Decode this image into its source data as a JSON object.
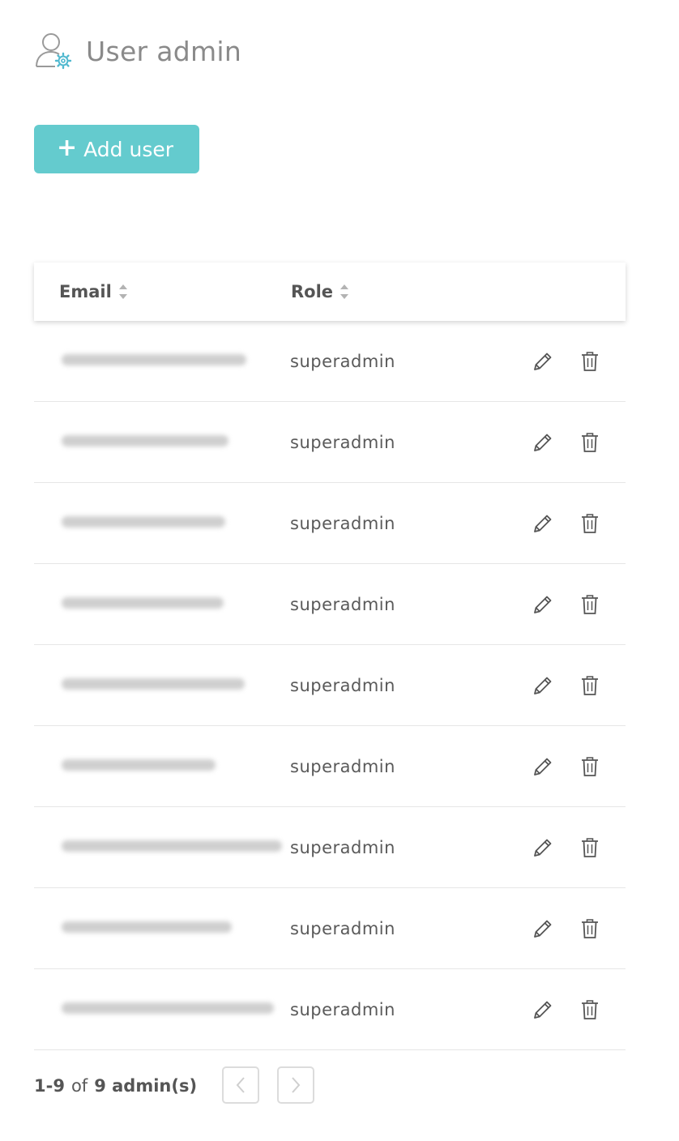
{
  "header": {
    "title": "User admin",
    "icon": "user-gear-icon"
  },
  "toolbar": {
    "add_label": "Add user",
    "add_icon": "plus-icon"
  },
  "table": {
    "columns": [
      {
        "label": "Email",
        "sort_icon": "sort-icon"
      },
      {
        "label": "Role",
        "sort_icon": "sort-icon"
      }
    ],
    "rows": [
      {
        "role": "superadmin"
      },
      {
        "role": "superadmin"
      },
      {
        "role": "superadmin"
      },
      {
        "role": "superadmin"
      },
      {
        "role": "superadmin"
      },
      {
        "role": "superadmin"
      },
      {
        "role": "superadmin"
      },
      {
        "role": "superadmin"
      },
      {
        "role": "superadmin"
      }
    ],
    "row_actions": [
      "pencil-icon",
      "trash-icon"
    ]
  },
  "pagination": {
    "range": "1-9",
    "of": "of",
    "total": "9 admin(s)",
    "prev_icon": "chevron-left-icon",
    "next_icon": "chevron-right-icon"
  },
  "colors": {
    "accent": "#64cbce",
    "text": "#555555",
    "muted": "#8a8a8a",
    "border": "#e6e6e6"
  }
}
